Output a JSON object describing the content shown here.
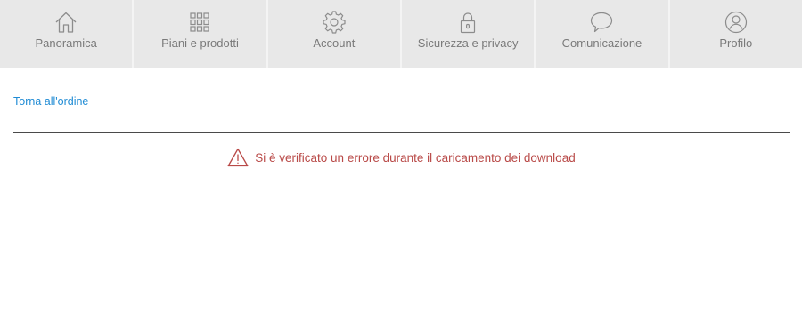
{
  "nav": {
    "items": [
      {
        "label": "Panoramica",
        "icon": "home-icon"
      },
      {
        "label": "Piani e prodotti",
        "icon": "grid-icon"
      },
      {
        "label": "Account",
        "icon": "gear-icon"
      },
      {
        "label": "Sicurezza e privacy",
        "icon": "lock-icon"
      },
      {
        "label": "Comunicazione",
        "icon": "speech-bubble-icon"
      },
      {
        "label": "Profilo",
        "icon": "user-profile-icon"
      }
    ],
    "background_color": "#e8e8e8",
    "label_color": "#7a7a7a"
  },
  "main": {
    "back_link": "Torna all'ordine",
    "back_link_color": "#1f8bd4",
    "error": {
      "icon": "warning-icon",
      "message": "Si è verificato un errore durante il caricamento dei download",
      "color": "#b94a48"
    }
  }
}
